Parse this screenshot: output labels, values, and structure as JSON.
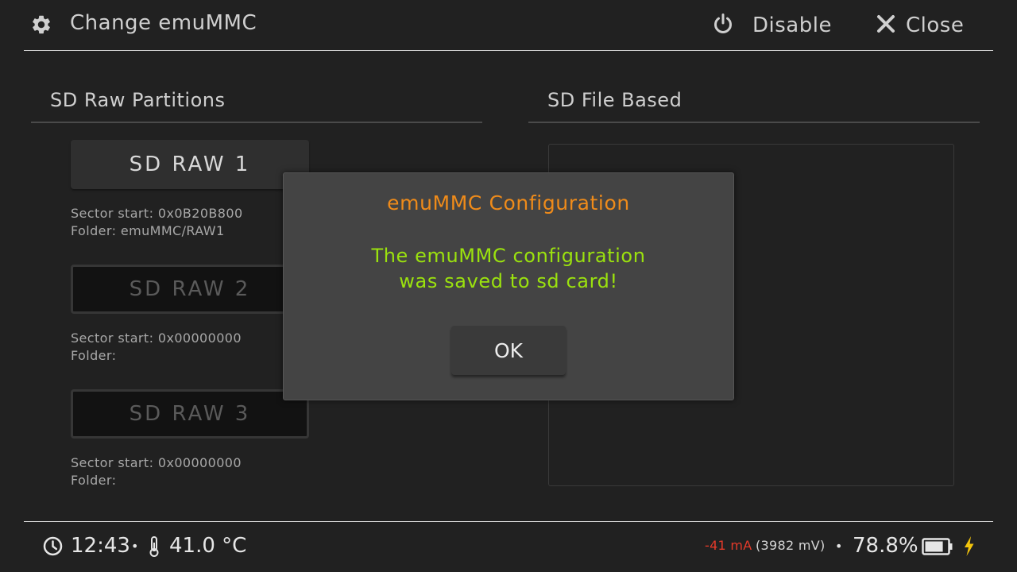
{
  "header": {
    "title": "Change emuMMC",
    "disable_label": "Disable",
    "close_label": "Close",
    "title_icon": "gear-icon",
    "disable_icon": "power-icon",
    "close_icon": "close-icon"
  },
  "sections": {
    "raw_title": "SD Raw Partitions",
    "file_title": "SD File Based"
  },
  "raw_partitions": [
    {
      "label": "SD RAW 1",
      "sector_line": "Sector start: 0x0B20B800",
      "folder_line": "Folder: emuMMC/RAW1",
      "state": "active"
    },
    {
      "label": "SD RAW 2",
      "sector_line": "Sector start: 0x00000000",
      "folder_line": "Folder:",
      "state": "inactive"
    },
    {
      "label": "SD RAW 3",
      "sector_line": "Sector start: 0x00000000",
      "folder_line": "Folder:",
      "state": "inactive"
    }
  ],
  "dialog": {
    "title": "emuMMC Configuration",
    "message_line1": "The emuMMC configuration",
    "message_line2": "was saved to sd card!",
    "ok_label": "OK",
    "title_color": "#ef8b1a",
    "message_color": "#9be20e"
  },
  "footer": {
    "time": "12:43",
    "temperature": "41.0 °C",
    "current": "-41 mA",
    "voltage": "(3982 mV)",
    "battery_percent": "78.8%",
    "battery_fill": 0.788,
    "separator": "•",
    "current_color": "#e53a2a",
    "charge_color": "#f2c40c",
    "icons": [
      "clock-icon",
      "thermometer-icon",
      "battery-icon",
      "charging-bolt-icon"
    ]
  }
}
